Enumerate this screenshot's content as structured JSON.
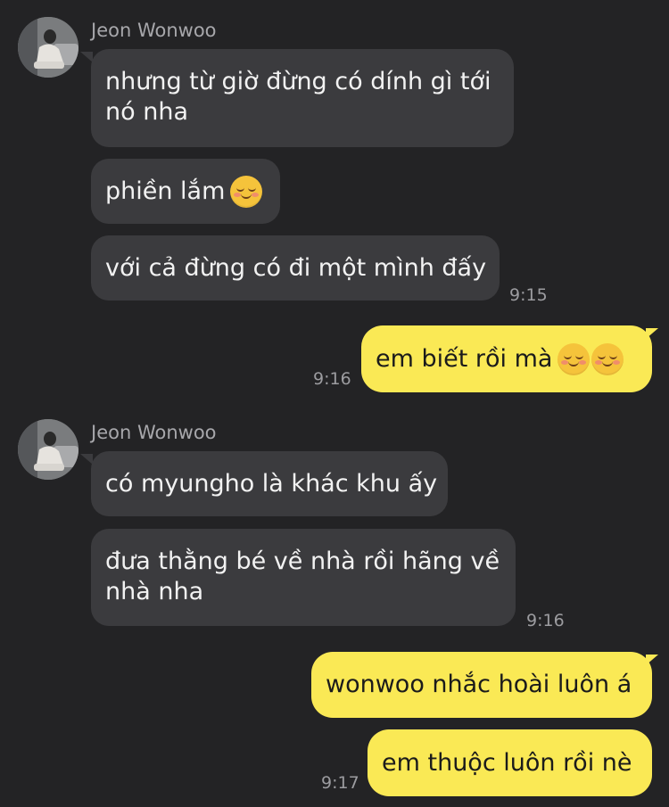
{
  "contact": {
    "name": "Jeon Wonwoo"
  },
  "groups": [
    {
      "sender": "Jeon Wonwoo",
      "messages": [
        "nhưng từ giờ đừng có dính gì tới nó nha",
        "phiền lắm",
        "với cả đừng có đi một mình đấy"
      ],
      "time": "9:15"
    },
    {
      "sender": "me",
      "messages": [
        "em biết rồi mà"
      ],
      "time": "9:16"
    },
    {
      "sender": "Jeon Wonwoo",
      "messages": [
        "có myungho là khác khu ấy",
        "đưa thằng bé về nhà rồi hãng về nhà nha"
      ],
      "time": "9:16"
    },
    {
      "sender": "me",
      "messages": [
        "wonwoo nhắc hoài luôn á",
        "em thuộc luôn rồi nè"
      ],
      "time": "9:17"
    }
  ],
  "emoji": {
    "name": "smiling-face-icon",
    "color": "#f5c33b"
  },
  "colors": {
    "background": "#232325",
    "incoming": "#3b3b3e",
    "outgoing": "#fae955"
  }
}
